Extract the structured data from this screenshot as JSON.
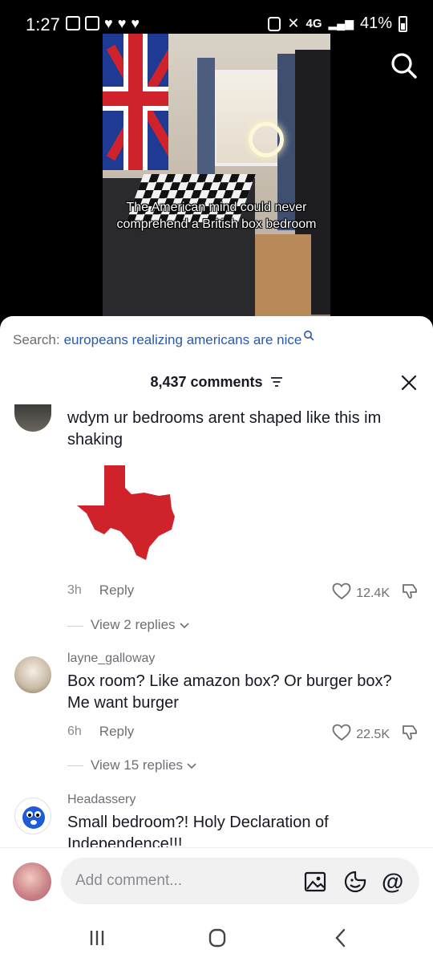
{
  "status_bar": {
    "time": "1:27",
    "network": "4G",
    "battery": "41%"
  },
  "video": {
    "caption": "The American mind could never comprehend a British box bedroom"
  },
  "search": {
    "label": "Search:",
    "term": "europeans realizing americans are nice"
  },
  "comments_header": {
    "count_label": "8,437 comments"
  },
  "comments": [
    {
      "username": "",
      "text": "wdym ur bedrooms arent shaped like this im shaking",
      "time": "3h",
      "reply_label": "Reply",
      "likes": "12.4K",
      "view_replies": "View 2 replies"
    },
    {
      "username": "layne_galloway",
      "text": "Box room? Like amazon box? Or burger box? Me want burger",
      "time": "6h",
      "reply_label": "Reply",
      "likes": "22.5K",
      "view_replies": "View 15 replies"
    },
    {
      "username": "Headassery",
      "text": "Small bedroom?! Holy Declaration of Independence!!!"
    }
  ],
  "input": {
    "placeholder": "Add comment..."
  },
  "colors": {
    "search_term": "#2b58a8",
    "texas_shape": "#d0222b"
  }
}
